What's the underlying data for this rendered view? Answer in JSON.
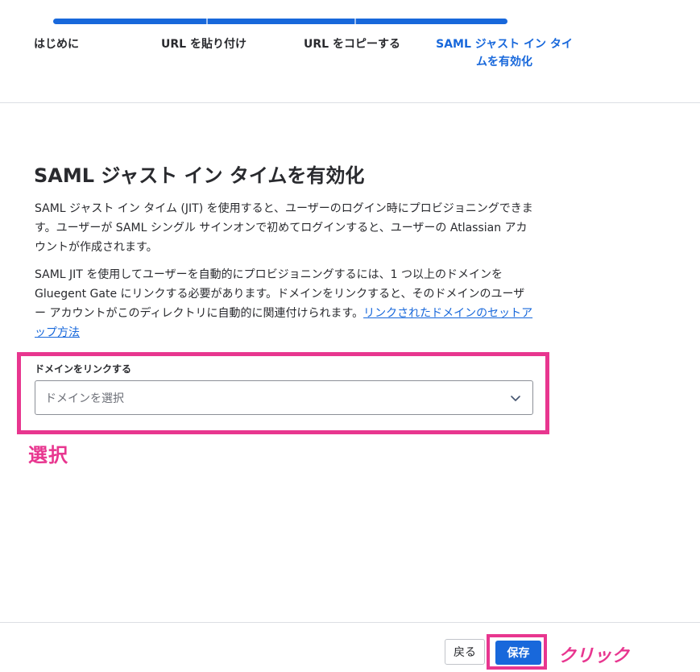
{
  "stepper": {
    "steps": [
      {
        "label": "はじめに",
        "state": "complete"
      },
      {
        "label": "URL を貼り付け",
        "state": "complete"
      },
      {
        "label": "URL をコピーする",
        "state": "complete"
      },
      {
        "label": "SAML ジャスト イン タイムを有効化",
        "state": "active"
      }
    ],
    "accent_color": "#1868db"
  },
  "main": {
    "title": "SAML ジャスト イン タイムを有効化",
    "paragraph1": "SAML ジャスト イン タイム (JIT) を使用すると、ユーザーのログイン時にプロビジョニングできます。ユーザーが SAML シングル サインオンで初めてログインすると、ユーザーの Atlassian アカウントが作成されます。",
    "paragraph2_text": "SAML JIT を使用してユーザーを自動的にプロビジョニングするには、1 つ以上のドメインを Gluegent Gate にリンクする必要があります。ドメインをリンクすると、そのドメインのユーザー アカウントがこのディレクトリに自動的に関連付けられます。",
    "paragraph2_link": "リンクされたドメインのセットアップ方法",
    "domain_field": {
      "label": "ドメインをリンクする",
      "placeholder": "ドメインを選択",
      "icon": "chevron-down-icon"
    }
  },
  "annotations": {
    "select": "選択",
    "click": "クリック",
    "color": "#e8368f"
  },
  "footer": {
    "back_label": "戻る",
    "save_label": "保存"
  }
}
